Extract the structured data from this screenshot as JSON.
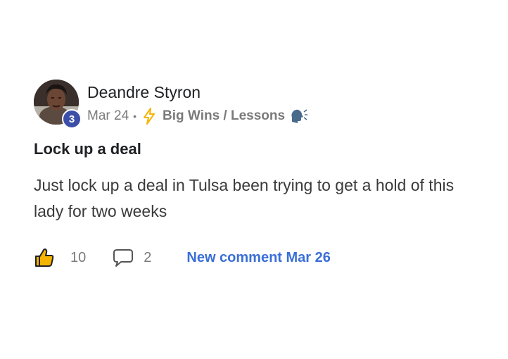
{
  "post": {
    "author": {
      "name": "Deandre Styron",
      "level": "3",
      "avatar_icon": "user-avatar-photo"
    },
    "meta": {
      "date": "Mar 24",
      "separator": "•",
      "category_icon": "lightning-bolt-icon",
      "category": "Big Wins / Lessons",
      "category_emoji_icon": "speaking-head-icon"
    },
    "title": "Lock up a deal",
    "body": "Just lock up a deal in Tulsa been trying to get a hold of this lady for two weeks",
    "actions": {
      "like_count": "10",
      "comment_count": "2",
      "new_comment": "New comment Mar 26"
    }
  },
  "colors": {
    "badge": "#3c4fa8",
    "link": "#3a6fd8",
    "bolt": "#f5b400",
    "muted": "#7a7a7a"
  }
}
